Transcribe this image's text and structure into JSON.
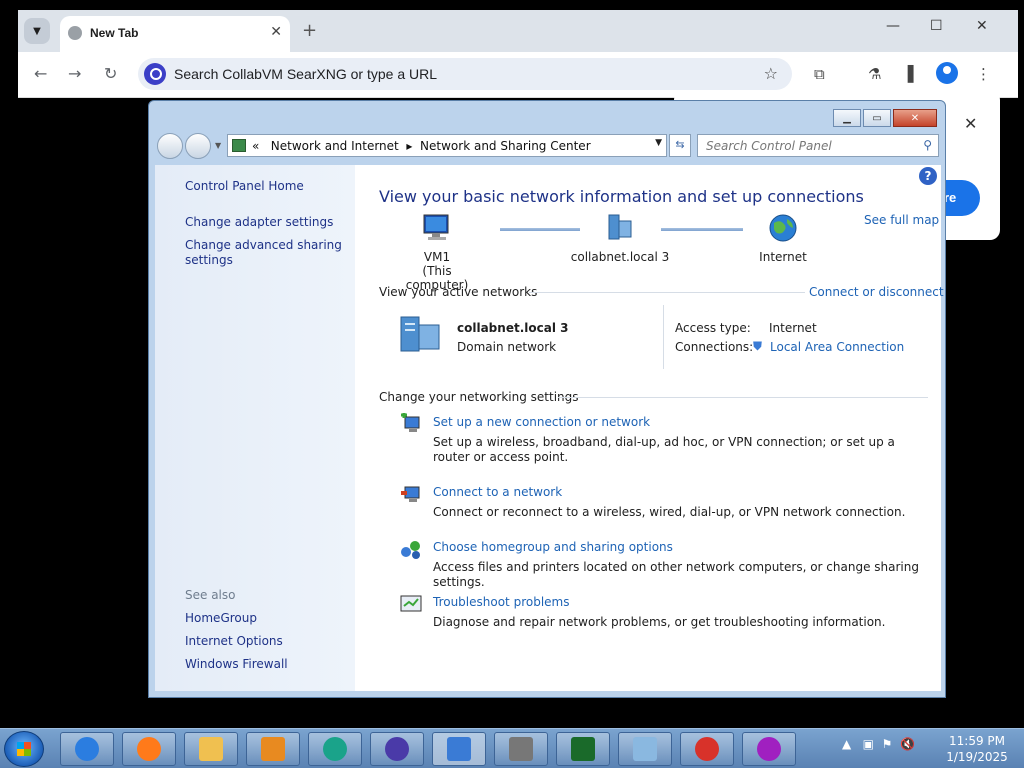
{
  "browser": {
    "tab_title": "New Tab",
    "omnibox_placeholder": "Search CollabVM SearXNG or type a URL",
    "popup_button": "ore"
  },
  "window": {
    "address": {
      "chevron": "«",
      "crumbs": [
        "Network and Internet",
        "Network and Sharing Center"
      ]
    },
    "search_placeholder": "Search Control Panel",
    "left_pane": {
      "home": "Control Panel Home",
      "links": [
        "Change adapter settings",
        "Change advanced sharing",
        "settings"
      ],
      "see_also_heading": "See also",
      "see_also": [
        "HomeGroup",
        "Internet Options",
        "Windows Firewall"
      ]
    },
    "main": {
      "title": "View your basic network information and set up connections",
      "see_full_map": "See full map",
      "map_nodes": [
        {
          "label": "VM1",
          "sub": "(This computer)"
        },
        {
          "label": "collabnet.local  3",
          "sub": ""
        },
        {
          "label": "Internet",
          "sub": ""
        }
      ],
      "active_networks_label": "View your active networks",
      "connect_or_disconnect": "Connect or disconnect",
      "network_name": "collabnet.local  3",
      "network_type": "Domain network",
      "access_type_label": "Access type:",
      "access_type_value": "Internet",
      "connections_label": "Connections:",
      "connections_value": "Local Area Connection",
      "change_settings_label": "Change your networking settings",
      "settings": [
        {
          "title": "Set up a new connection or network",
          "desc": "Set up a wireless, broadband, dial-up, ad hoc, or VPN connection; or set up a router or access point."
        },
        {
          "title": "Connect to a network",
          "desc": "Connect or reconnect to a wireless, wired, dial-up, or VPN network connection."
        },
        {
          "title": "Choose homegroup and sharing options",
          "desc": "Access files and printers located on other network computers, or change sharing settings."
        },
        {
          "title": "Troubleshoot problems",
          "desc": "Diagnose and repair network problems, or get troubleshooting information."
        }
      ]
    }
  },
  "taskbar": {
    "time": "11:59 PM",
    "date": "1/19/2025"
  }
}
